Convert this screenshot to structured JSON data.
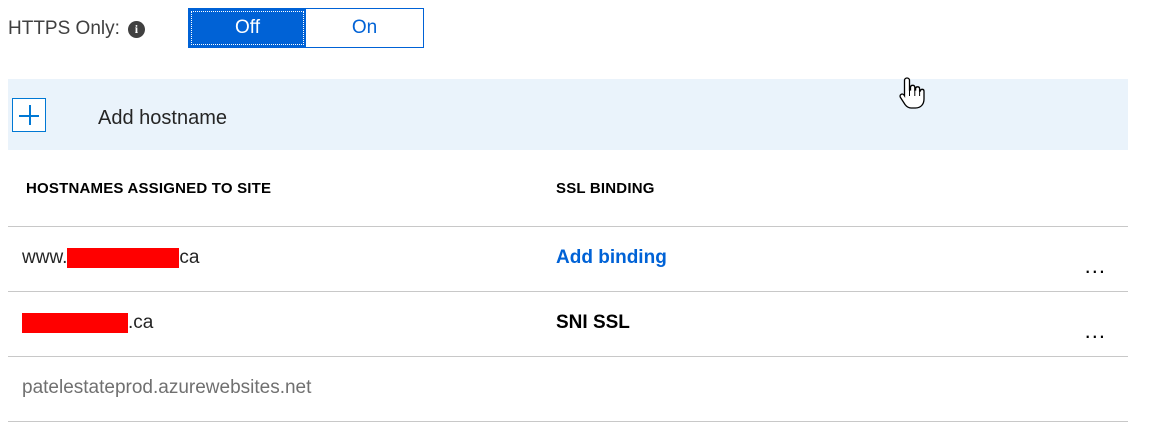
{
  "https": {
    "label": "HTTPS Only:",
    "info_icon": "info-icon",
    "options": [
      "Off",
      "On"
    ],
    "selected": "Off"
  },
  "add_hostname": {
    "label": "Add hostname",
    "icon": "plus-icon"
  },
  "table": {
    "headers": [
      "HOSTNAMES ASSIGNED TO SITE",
      "SSL BINDING"
    ],
    "rows": [
      {
        "host_prefix": "www.",
        "host_suffix": "ca",
        "ssl": "Add binding",
        "ssl_is_link": true,
        "more": "..."
      },
      {
        "host_prefix": "",
        "host_suffix": ".ca",
        "ssl": "SNI SSL",
        "ssl_is_link": false,
        "more": "..."
      },
      {
        "host": "patelestateprod.azurewebsites.net"
      }
    ]
  },
  "colors": {
    "accent": "#0062d6",
    "add_bar_bg": "#eaf3fb",
    "redaction": "#ff0000"
  }
}
